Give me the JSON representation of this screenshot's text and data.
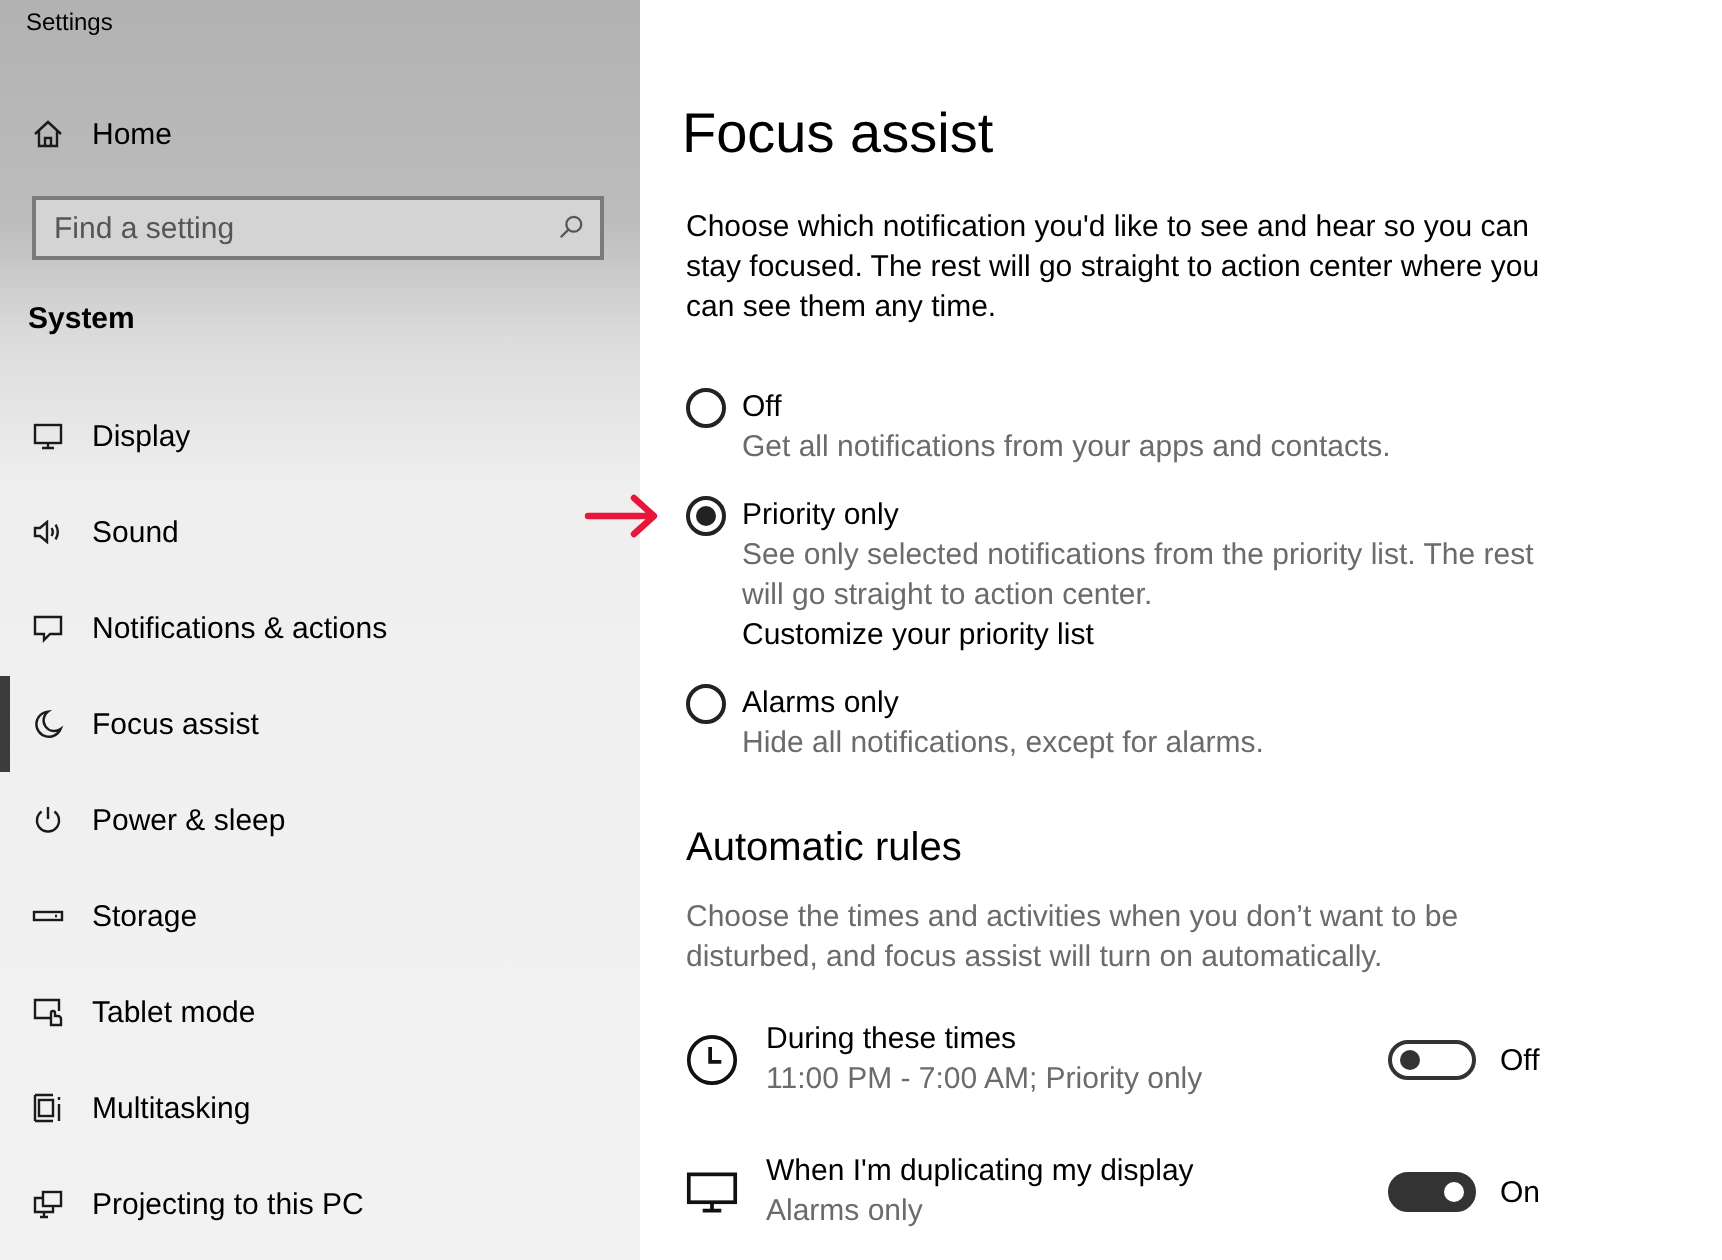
{
  "window": {
    "title": "Settings"
  },
  "sidebar": {
    "home": {
      "label": "Home"
    },
    "search": {
      "placeholder": "Find a setting"
    },
    "section": "System",
    "items": [
      {
        "label": "Display",
        "kind": "display",
        "selected": false
      },
      {
        "label": "Sound",
        "kind": "sound",
        "selected": false
      },
      {
        "label": "Notifications & actions",
        "kind": "notifications",
        "selected": false
      },
      {
        "label": "Focus assist",
        "kind": "focus",
        "selected": true
      },
      {
        "label": "Power & sleep",
        "kind": "power",
        "selected": false
      },
      {
        "label": "Storage",
        "kind": "storage",
        "selected": false
      },
      {
        "label": "Tablet mode",
        "kind": "tablet",
        "selected": false
      },
      {
        "label": "Multitasking",
        "kind": "multitasking",
        "selected": false
      },
      {
        "label": "Projecting to this PC",
        "kind": "projecting",
        "selected": false
      }
    ]
  },
  "page": {
    "title": "Focus assist",
    "intro": "Choose which notification you'd like to see and hear so you can stay focused. The rest will go straight to action center where you can see them any time.",
    "options": [
      {
        "label": "Off",
        "description": "Get all notifications from your apps and contacts.",
        "selected": false,
        "highlighted": false
      },
      {
        "label": "Priority only",
        "description": "See only selected notifications from the priority list. The rest will go straight to action center.",
        "link": "Customize your priority list",
        "selected": true,
        "highlighted": true
      },
      {
        "label": "Alarms only",
        "description": "Hide all notifications, except for alarms.",
        "selected": false,
        "highlighted": false
      }
    ]
  },
  "automatic_rules": {
    "title": "Automatic rules",
    "description": "Choose the times and activities when you don’t want to be disturbed, and focus assist will turn on automatically.",
    "rules": [
      {
        "kind": "clock",
        "title": "During these times",
        "detail": "11:00 PM - 7:00 AM; Priority only",
        "on": false,
        "state_label": "Off"
      },
      {
        "kind": "monitor",
        "title": "When I'm duplicating my display",
        "detail": "Alarms only",
        "on": true,
        "state_label": "On"
      }
    ]
  }
}
